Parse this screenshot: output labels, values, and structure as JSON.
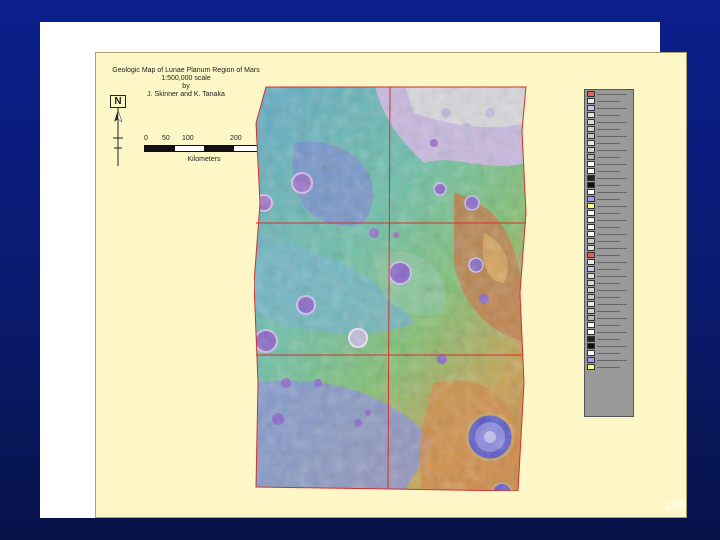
{
  "map": {
    "title_lines": [
      "Geologic Map of Lunae Planum Region of Mars",
      "1:500,000 scale",
      "by",
      "J. Skinner and K. Tanaka"
    ],
    "north_label": "N",
    "scale": {
      "ticks": [
        "0",
        "50",
        "100",
        "200"
      ],
      "unit": "Kilometers"
    }
  },
  "legend": {
    "swatch_colors": [
      "#e06060",
      "#e8e8e8",
      "#c8c8f0",
      "#e0e0e0",
      "#d8d8d8",
      "#d0d0d0",
      "#c8c8c8",
      "#e8e8e8",
      "#d0d0d0",
      "#b8b8b8",
      "#ffffff",
      "#ffffff",
      "#222222",
      "#111111",
      "#ffffff",
      "#a0a0f0",
      "#ffff80",
      "#ffffff",
      "#f0f0f0",
      "#ffffff",
      "#ffffff",
      "#cccccc",
      "#e0e0e0"
    ]
  },
  "slide": {
    "page_number": "106"
  }
}
